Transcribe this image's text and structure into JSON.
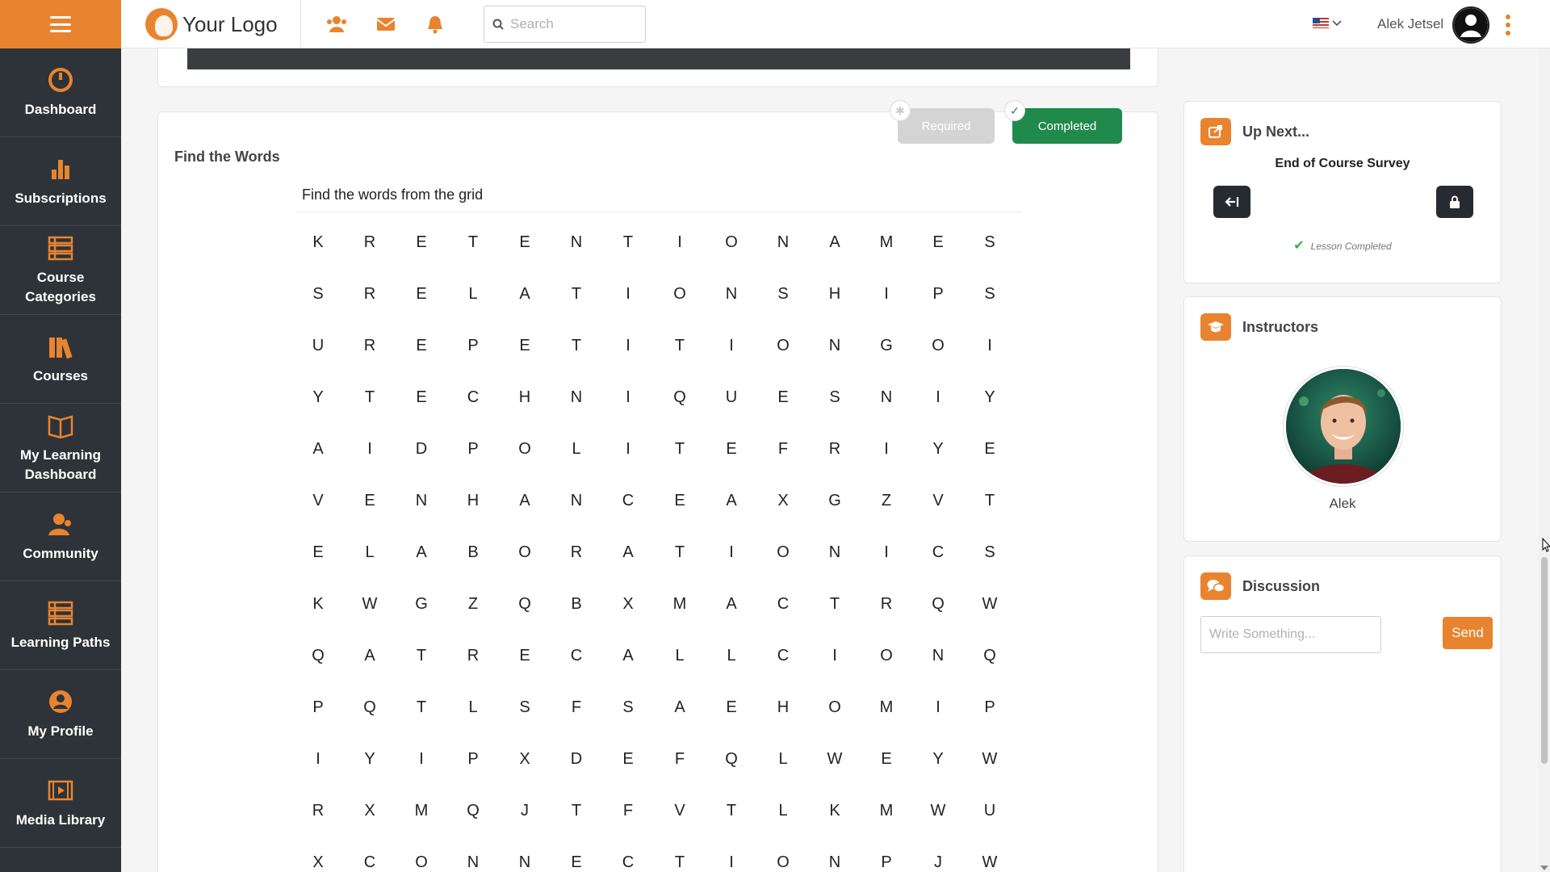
{
  "header": {
    "logo_text": "Your Logo",
    "search_placeholder": "Search",
    "user_name": "Alek Jetsel",
    "icons": [
      "users-icon",
      "mail-icon",
      "bell-icon",
      "search-icon",
      "flag-us-icon",
      "user-avatar-icon",
      "kebab-menu-icon"
    ]
  },
  "sidebar": {
    "items": [
      {
        "label": "Dashboard",
        "icon": "dashboard-gauge-icon"
      },
      {
        "label": "Subscriptions",
        "icon": "bar-chart-icon"
      },
      {
        "label": "Course Categories",
        "icon": "list-icon"
      },
      {
        "label": "Courses",
        "icon": "books-icon"
      },
      {
        "label": "My Learning Dashboard",
        "icon": "open-book-icon"
      },
      {
        "label": "Community",
        "icon": "community-icon"
      },
      {
        "label": "Learning Paths",
        "icon": "list-icon"
      },
      {
        "label": "My Profile",
        "icon": "profile-icon"
      },
      {
        "label": "Media Library",
        "icon": "film-icon"
      }
    ]
  },
  "lesson": {
    "badge_required": "Required",
    "badge_completed": "Completed",
    "title": "Find the Words",
    "instruction": "Find the words from the grid",
    "grid": [
      [
        "K",
        "R",
        "E",
        "T",
        "E",
        "N",
        "T",
        "I",
        "O",
        "N",
        "A",
        "M",
        "E",
        "S"
      ],
      [
        "S",
        "R",
        "E",
        "L",
        "A",
        "T",
        "I",
        "O",
        "N",
        "S",
        "H",
        "I",
        "P",
        "S"
      ],
      [
        "U",
        "R",
        "E",
        "P",
        "E",
        "T",
        "I",
        "T",
        "I",
        "O",
        "N",
        "G",
        "O",
        "I"
      ],
      [
        "Y",
        "T",
        "E",
        "C",
        "H",
        "N",
        "I",
        "Q",
        "U",
        "E",
        "S",
        "N",
        "I",
        "Y"
      ],
      [
        "A",
        "I",
        "D",
        "P",
        "O",
        "L",
        "I",
        "T",
        "E",
        "F",
        "R",
        "I",
        "Y",
        "E"
      ],
      [
        "V",
        "E",
        "N",
        "H",
        "A",
        "N",
        "C",
        "E",
        "A",
        "X",
        "G",
        "Z",
        "V",
        "T"
      ],
      [
        "E",
        "L",
        "A",
        "B",
        "O",
        "R",
        "A",
        "T",
        "I",
        "O",
        "N",
        "I",
        "C",
        "S"
      ],
      [
        "K",
        "W",
        "G",
        "Z",
        "Q",
        "B",
        "X",
        "M",
        "A",
        "C",
        "T",
        "R",
        "Q",
        "W"
      ],
      [
        "Q",
        "A",
        "T",
        "R",
        "E",
        "C",
        "A",
        "L",
        "L",
        "C",
        "I",
        "O",
        "N",
        "Q"
      ],
      [
        "P",
        "Q",
        "T",
        "L",
        "S",
        "F",
        "S",
        "A",
        "E",
        "H",
        "O",
        "M",
        "I",
        "P"
      ],
      [
        "I",
        "Y",
        "I",
        "P",
        "X",
        "D",
        "E",
        "F",
        "Q",
        "L",
        "W",
        "E",
        "Y",
        "W"
      ],
      [
        "R",
        "X",
        "M",
        "Q",
        "J",
        "T",
        "F",
        "V",
        "T",
        "L",
        "K",
        "M",
        "W",
        "U"
      ],
      [
        "X",
        "C",
        "O",
        "N",
        "N",
        "E",
        "C",
        "T",
        "I",
        "O",
        "N",
        "P",
        "J",
        "W"
      ]
    ]
  },
  "up_next": {
    "title": "Up Next...",
    "course": "End of Course Survey",
    "status": "Lesson Completed"
  },
  "instructors": {
    "title": "Instructors",
    "name": "Alek"
  },
  "discussion": {
    "title": "Discussion",
    "placeholder": "Write Something...",
    "send_label": "Send"
  },
  "colors": {
    "accent": "#e8842f",
    "sidebar_bg": "#2d3338",
    "completed_green": "#1f8a4c",
    "required_gray": "#d4d4d4"
  }
}
